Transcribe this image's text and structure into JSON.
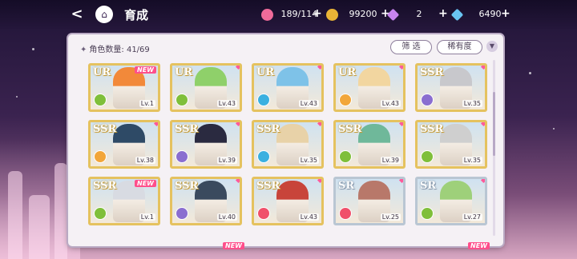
{
  "header": {
    "title": "育成",
    "resources": [
      {
        "icon": "candy-icon",
        "value": "189/114",
        "color": "#f06b9a"
      },
      {
        "icon": "gold-coin-icon",
        "value": "99200",
        "color": "#e9b436"
      },
      {
        "icon": "pink-gem-icon",
        "value": "2",
        "color": "#c884f0"
      },
      {
        "icon": "blue-gem-icon",
        "value": "6490",
        "color": "#69c4f2"
      }
    ]
  },
  "panel": {
    "count_label": "角色数量:",
    "count_value": "41/69",
    "filter_label": "筛 选",
    "sort_label": "稀有度"
  },
  "cards": [
    {
      "rarity": "UR",
      "level": "Lv.1",
      "new": "NEW",
      "attr_color": "#7fbf3a",
      "portrait": "#f2893a"
    },
    {
      "rarity": "UR",
      "level": "Lv.43",
      "new": "",
      "attr_color": "#7fbf3a",
      "portrait": "#8fd06a"
    },
    {
      "rarity": "UR",
      "level": "Lv.43",
      "new": "",
      "attr_color": "#3bb0e0",
      "portrait": "#7ec2e8"
    },
    {
      "rarity": "UR",
      "level": "Lv.43",
      "new": "",
      "attr_color": "#f2a63a",
      "portrait": "#f2d6a0"
    },
    {
      "rarity": "SSR",
      "level": "Lv.35",
      "new": "",
      "attr_color": "#8a6ed0",
      "portrait": "#c8c8cc"
    },
    {
      "rarity": "SSR",
      "level": "Lv.38",
      "new": "",
      "attr_color": "#f2a63a",
      "portrait": "#2e4a66"
    },
    {
      "rarity": "SSR",
      "level": "Lv.39",
      "new": "",
      "attr_color": "#8a6ed0",
      "portrait": "#2a2a40"
    },
    {
      "rarity": "SSR",
      "level": "Lv.35",
      "new": "",
      "attr_color": "#3bb0e0",
      "portrait": "#e8d2a8"
    },
    {
      "rarity": "SSR",
      "level": "Lv.39",
      "new": "",
      "attr_color": "#7fbf3a",
      "portrait": "#6fb89a"
    },
    {
      "rarity": "SSR",
      "level": "Lv.35",
      "new": "",
      "attr_color": "#7fbf3a",
      "portrait": "#cfcfcf"
    },
    {
      "rarity": "SSR",
      "level": "Lv.1",
      "new": "NEW",
      "attr_color": "#7fbf3a",
      "portrait": "#d8dbe2"
    },
    {
      "rarity": "SSR",
      "level": "Lv.40",
      "new": "",
      "attr_color": "#8a6ed0",
      "portrait": "#3a4a5e"
    },
    {
      "rarity": "SSR",
      "level": "Lv.43",
      "new": "",
      "attr_color": "#f0506a",
      "portrait": "#c8443a"
    },
    {
      "rarity": "SR",
      "level": "Lv.25",
      "new": "",
      "attr_color": "#f0506a",
      "portrait": "#b8786a"
    },
    {
      "rarity": "SR",
      "level": "Lv.27",
      "new": "",
      "attr_color": "#7fbf3a",
      "portrait": "#9ed07a"
    }
  ],
  "peek_row": [
    {
      "new": "NEW"
    },
    {
      "new": "NEW"
    }
  ]
}
